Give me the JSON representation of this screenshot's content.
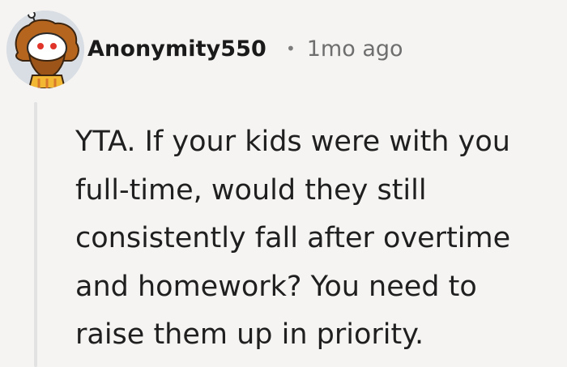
{
  "comment": {
    "avatar": "user-avatar-illustration",
    "username": "Anonymity550",
    "separator": "•",
    "timestamp": "1mo ago",
    "body_lines": [
      "YTA. If your kids were with you",
      "full-time, would they still",
      "consistently fall after overtime",
      "and homework? You need to",
      "raise them up in priority."
    ]
  }
}
